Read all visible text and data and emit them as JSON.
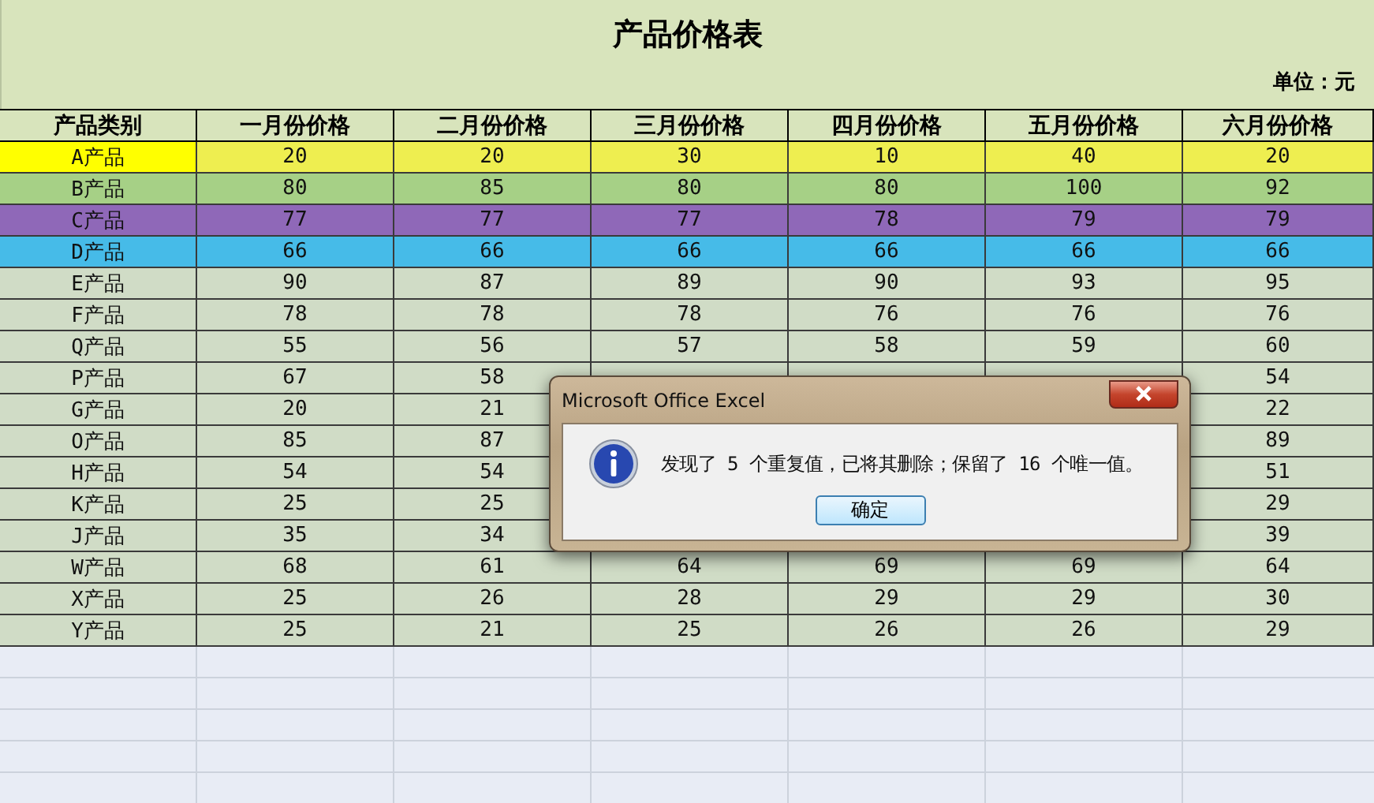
{
  "sheet": {
    "title": "产品价格表",
    "unit": "单位：元",
    "columns": [
      "产品类别",
      "一月份价格",
      "二月份价格",
      "三月份价格",
      "四月份价格",
      "五月份价格",
      "六月份价格"
    ],
    "rows": [
      {
        "name": "A产品",
        "color": "#eeee50",
        "label_highlight": true,
        "values": [
          "20",
          "20",
          "30",
          "10",
          "40",
          "20"
        ]
      },
      {
        "name": "B产品",
        "color": "#a6d086",
        "values": [
          "80",
          "85",
          "80",
          "80",
          "100",
          "92"
        ]
      },
      {
        "name": "C产品",
        "color": "#8f68b8",
        "values": [
          "77",
          "77",
          "77",
          "78",
          "79",
          "79"
        ]
      },
      {
        "name": "D产品",
        "color": "#46bbe8",
        "values": [
          "66",
          "66",
          "66",
          "66",
          "66",
          "66"
        ]
      },
      {
        "name": "E产品",
        "color": "#d0dcc6",
        "values": [
          "90",
          "87",
          "89",
          "90",
          "93",
          "95"
        ]
      },
      {
        "name": "F产品",
        "color": "#d0dcc6",
        "values": [
          "78",
          "78",
          "78",
          "76",
          "76",
          "76"
        ]
      },
      {
        "name": "Q产品",
        "color": "#d0dcc6",
        "values": [
          "55",
          "56",
          "57",
          "58",
          "59",
          "60"
        ]
      },
      {
        "name": "P产品",
        "color": "#d0dcc6",
        "values": [
          "67",
          "58",
          "54"
        ]
      },
      {
        "name": "G产品",
        "color": "#d0dcc6",
        "values": [
          "20",
          "21",
          "22"
        ]
      },
      {
        "name": "O产品",
        "color": "#d0dcc6",
        "values": [
          "85",
          "87",
          "89"
        ]
      },
      {
        "name": "H产品",
        "color": "#d0dcc6",
        "values": [
          "54",
          "54",
          "51"
        ]
      },
      {
        "name": "K产品",
        "color": "#d0dcc6",
        "values": [
          "25",
          "25",
          "29"
        ]
      },
      {
        "name": "J产品",
        "color": "#d0dcc6",
        "values": [
          "35",
          "34",
          "39"
        ]
      },
      {
        "name": "W产品",
        "color": "#d0dcc6",
        "values": [
          "68",
          "61",
          "64",
          "69",
          "69",
          "64"
        ]
      },
      {
        "name": "X产品",
        "color": "#d0dcc6",
        "values": [
          "25",
          "26",
          "28",
          "29",
          "29",
          "30"
        ]
      },
      {
        "name": "Y产品",
        "color": "#d0dcc6",
        "values": [
          "25",
          "21",
          "25",
          "26",
          "26",
          "29"
        ]
      }
    ]
  },
  "dialog": {
    "title": "Microsoft Office Excel",
    "message": "发现了 5 个重复值，已将其删除；保留了 16 个唯一值。",
    "button": "确定"
  }
}
